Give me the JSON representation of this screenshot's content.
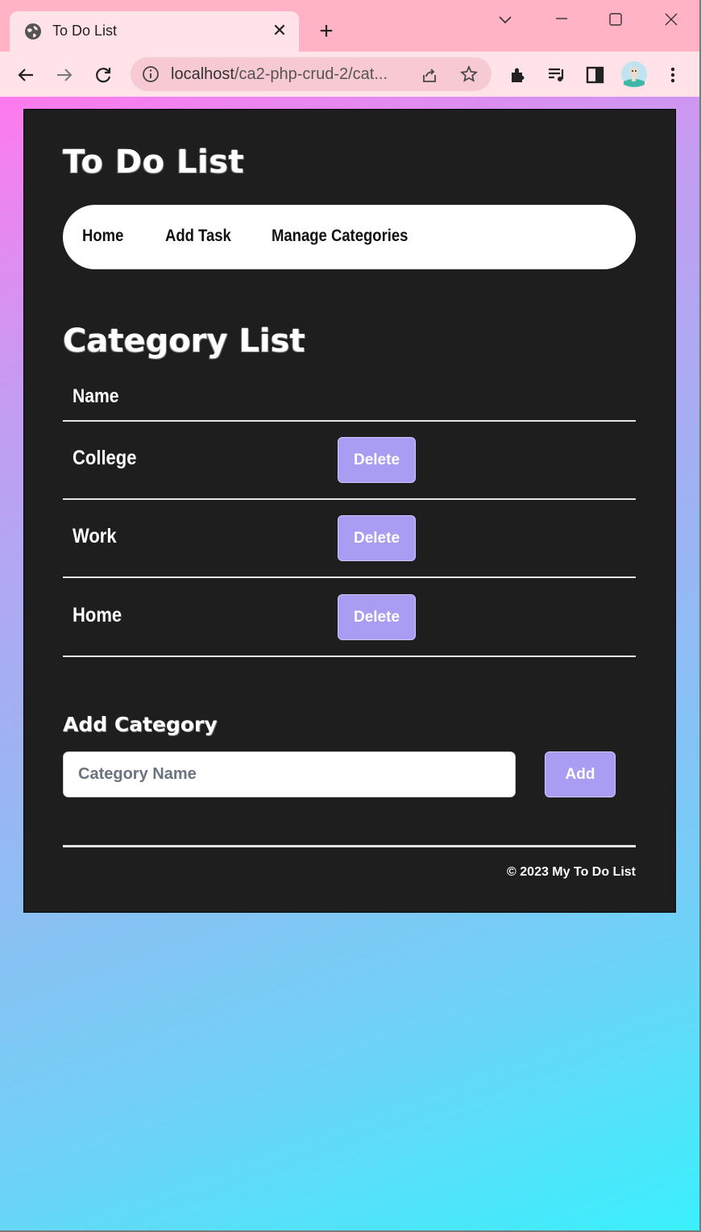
{
  "browser": {
    "tab_title": "To Do List",
    "url_host": "localhost",
    "url_path": "/ca2-php-crud-2/cat...",
    "icons": [
      "globe-icon",
      "close-icon",
      "plus-icon",
      "chevron-down-icon",
      "minimize-icon",
      "maximize-icon",
      "window-close-icon",
      "back-icon",
      "forward-icon",
      "reload-icon",
      "info-icon",
      "share-icon",
      "star-icon",
      "extensions-icon",
      "media-icon",
      "sidepanel-icon",
      "avatar",
      "menu-icon"
    ]
  },
  "site": {
    "title": "To Do List",
    "nav": [
      {
        "label": "Home"
      },
      {
        "label": "Add Task"
      },
      {
        "label": "Manage Categories"
      }
    ]
  },
  "categories": {
    "title": "Category List",
    "column_header": "Name",
    "rows": [
      {
        "name": "College",
        "action": "Delete"
      },
      {
        "name": "Work",
        "action": "Delete"
      },
      {
        "name": "Home",
        "action": "Delete"
      }
    ]
  },
  "add_category": {
    "title": "Add Category",
    "placeholder": "Category Name",
    "value": "",
    "button_label": "Add"
  },
  "footer": {
    "text": "© 2023 My To Do List"
  },
  "colors": {
    "card_bg": "#1e1e1e",
    "button_bg": "#a99cf3",
    "gradient_start": "#ff7aee",
    "gradient_end": "#3af0fc",
    "chrome_bg": "#ffb3c4"
  }
}
